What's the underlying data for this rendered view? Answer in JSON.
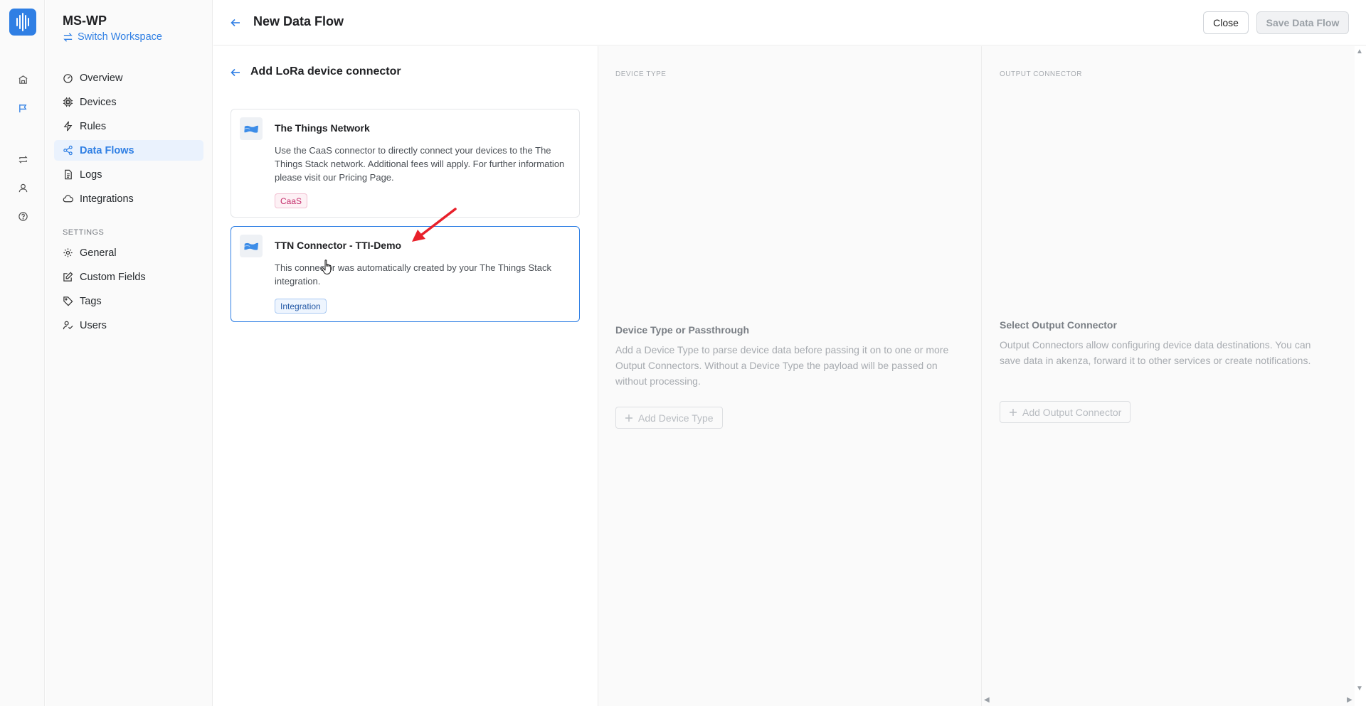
{
  "workspace": {
    "name": "MS-WP",
    "switch_label": "Switch Workspace"
  },
  "rail": {
    "items": [
      "home-icon",
      "flag-icon",
      "repeat-icon",
      "user-icon",
      "help-icon"
    ]
  },
  "nav": {
    "items": [
      {
        "label": "Overview",
        "icon": "dashboard-icon"
      },
      {
        "label": "Devices",
        "icon": "chip-icon"
      },
      {
        "label": "Rules",
        "icon": "bolt-icon"
      },
      {
        "label": "Data Flows",
        "icon": "share-icon",
        "active": true
      },
      {
        "label": "Logs",
        "icon": "log-icon"
      },
      {
        "label": "Integrations",
        "icon": "cloud-icon"
      }
    ],
    "settings_heading": "SETTINGS",
    "settings_items": [
      {
        "label": "General",
        "icon": "gear-icon"
      },
      {
        "label": "Custom Fields",
        "icon": "edit-icon"
      },
      {
        "label": "Tags",
        "icon": "tag-icon"
      },
      {
        "label": "Users",
        "icon": "users-icon"
      }
    ]
  },
  "header": {
    "title": "New Data Flow",
    "close_label": "Close",
    "save_label": "Save Data Flow"
  },
  "connector_panel": {
    "title": "Add LoRa device connector",
    "cards": [
      {
        "title": "The Things Network",
        "description": "Use the CaaS connector to directly connect your devices to the The Things Stack network. Additional fees will apply. For further information please visit our Pricing Page.",
        "tag": "CaaS"
      },
      {
        "title": "TTN Connector - TTI-Demo",
        "description": "This connector was automatically created by your The Things Stack integration.",
        "tag": "Integration",
        "selected": true
      }
    ]
  },
  "device_type_column": {
    "heading": "DEVICE TYPE",
    "title": "Device Type or Passthrough",
    "description": "Add a Device Type to parse device data before passing it on to one or more Output Connectors. Without a Device Type the payload will be passed on without processing.",
    "button_label": "Add Device Type"
  },
  "output_column": {
    "heading": "OUTPUT CONNECTOR",
    "title": "Select Output Connector",
    "description": "Output Connectors allow configuring device data destinations. You can save data in akenza, forward it to other services or create notifications.",
    "button_label": "Add Output Connector"
  },
  "colors": {
    "accent": "#2f7fe4",
    "annotation": "#e8202a",
    "tag_caas": "#c42d6b",
    "tag_integration": "#2459a6"
  }
}
